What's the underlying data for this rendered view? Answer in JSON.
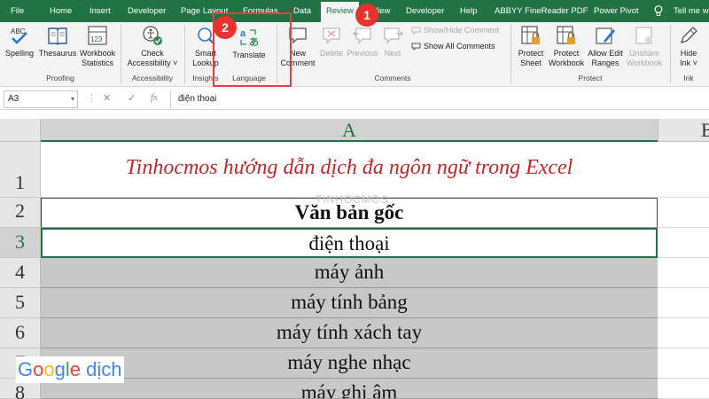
{
  "tabs": [
    {
      "label": "File"
    },
    {
      "label": "Home"
    },
    {
      "label": "Insert"
    },
    {
      "label": "Developer"
    },
    {
      "label": "Page Layout"
    },
    {
      "label": "Formulas"
    },
    {
      "label": "Data"
    },
    {
      "label": "Review"
    },
    {
      "label": "View"
    },
    {
      "label": "Developer"
    },
    {
      "label": "Help"
    },
    {
      "label": "ABBYY FineReader PDF"
    },
    {
      "label": "Power Pivot"
    },
    {
      "label": "Tell me wh"
    }
  ],
  "ribbon": {
    "spelling": {
      "line1": "ABC",
      "label": "Spelling"
    },
    "thesaurus": {
      "label": "Thesaurus"
    },
    "workbook_statistics": {
      "line1": "Workbook",
      "line2": "Statistics",
      "icon_text": "123"
    },
    "proofing_label": "Proofing",
    "check_accessibility": {
      "line1": "Check",
      "line2": "Accessibility ˅"
    },
    "accessibility_label": "Accessibility",
    "smart_lookup": {
      "line1": "Smart",
      "line2": "Lookup"
    },
    "insights_label": "Insights",
    "translate": {
      "label": "Translate"
    },
    "language_label": "Language",
    "new_comment": {
      "line1": "New",
      "line2": "Comment"
    },
    "delete": {
      "label": "Delete"
    },
    "previous": {
      "label": "Previous"
    },
    "next": {
      "label": "Next"
    },
    "show_hide_comment": {
      "label": "Show/Hide Comment"
    },
    "show_all_comments": {
      "label": "Show All Comments"
    },
    "comments_label": "Comments",
    "protect_sheet": {
      "line1": "Protect",
      "line2": "Sheet"
    },
    "protect_workbook": {
      "line1": "Protect",
      "line2": "Workbook"
    },
    "allow_edit_ranges": {
      "line1": "Allow Edit",
      "line2": "Ranges"
    },
    "unshare_workbook": {
      "line1": "Unshare",
      "line2": "Workbook"
    },
    "protect_label": "Protect",
    "hide_ink": {
      "line1": "Hide",
      "line2": "Ink ˅"
    },
    "ink_label": "Ink"
  },
  "annotations": {
    "badge1": "1",
    "badge2": "2"
  },
  "formula_bar": {
    "name_box": "A3",
    "name_box_arrow": "▾",
    "cancel": "✕",
    "enter": "✓",
    "fx": "fx",
    "value": "điện thoại"
  },
  "grid": {
    "col_a": "A",
    "col_b": "B",
    "rows": [
      {
        "num": "1",
        "text": "Tinhocmos hướng dẫn dịch đa ngôn ngữ trong Excel"
      },
      {
        "num": "2",
        "text": "Văn bản gốc"
      },
      {
        "num": "3",
        "text": "điện thoại"
      },
      {
        "num": "4",
        "text": "máy ảnh"
      },
      {
        "num": "5",
        "text": "máy tính bảng"
      },
      {
        "num": "6",
        "text": "máy tính xách tay"
      },
      {
        "num": "7",
        "text": "máy nghe nhạc"
      },
      {
        "num": "8",
        "text": "máy ghi âm"
      }
    ],
    "watermark": "TINHOCMOS"
  },
  "logo": {
    "g1": "G",
    "o1": "o",
    "o2": "o",
    "g2": "g",
    "l": "l",
    "e": "e",
    "suffix": " dịch"
  },
  "colors": {
    "excel_green": "#217346",
    "title_red": "#c0282a",
    "badge_red": "#e8322d",
    "cell_gray": "#c8c8c8"
  }
}
